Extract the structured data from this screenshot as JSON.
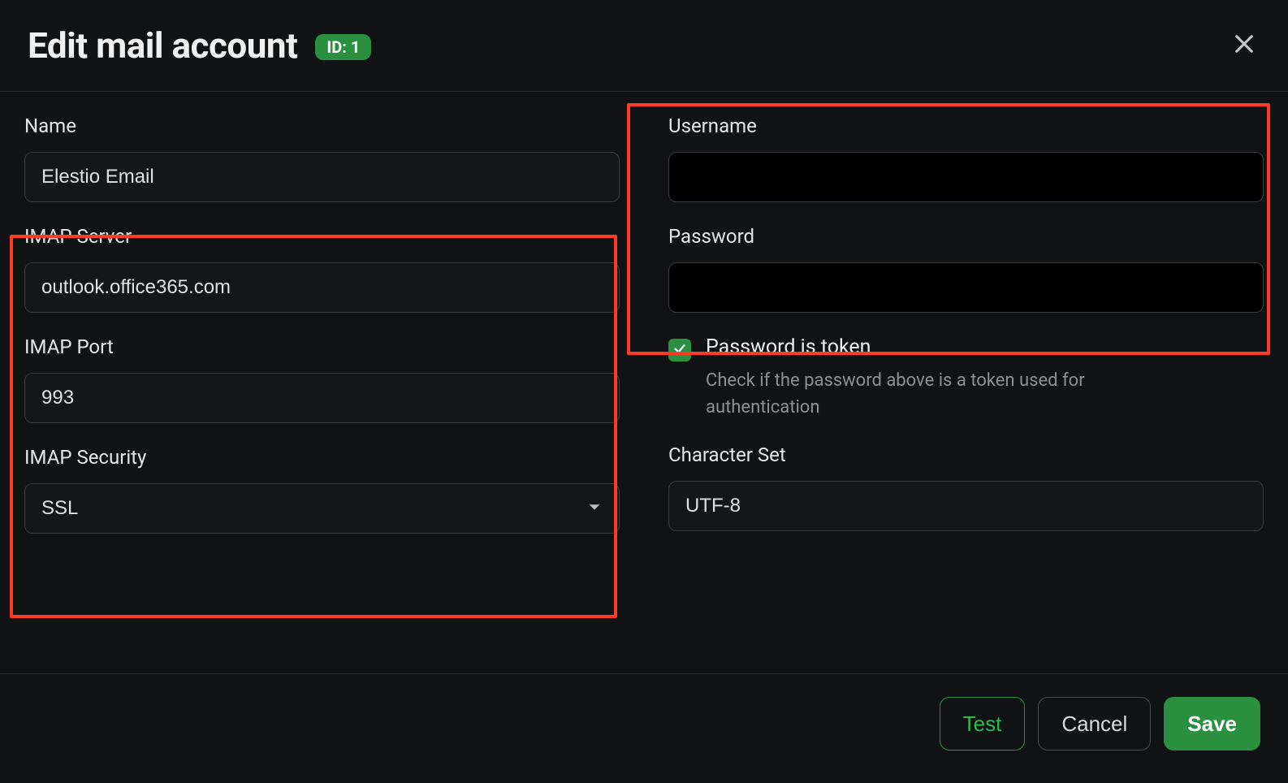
{
  "header": {
    "title": "Edit mail account",
    "id_badge": "ID: 1"
  },
  "left": {
    "name": {
      "label": "Name",
      "value": "Elestio Email"
    },
    "imap_server": {
      "label": "IMAP Server",
      "value": "outlook.office365.com"
    },
    "imap_port": {
      "label": "IMAP Port",
      "value": "993"
    },
    "imap_security": {
      "label": "IMAP Security",
      "value": "SSL"
    }
  },
  "right": {
    "username": {
      "label": "Username",
      "value": ""
    },
    "password": {
      "label": "Password",
      "value": ""
    },
    "password_is_token": {
      "label": "Password is token",
      "desc": "Check if the password above is a token used for authentication",
      "checked": true
    },
    "charset": {
      "label": "Character Set",
      "value": "UTF-8"
    }
  },
  "footer": {
    "test": "Test",
    "cancel": "Cancel",
    "save": "Save"
  }
}
